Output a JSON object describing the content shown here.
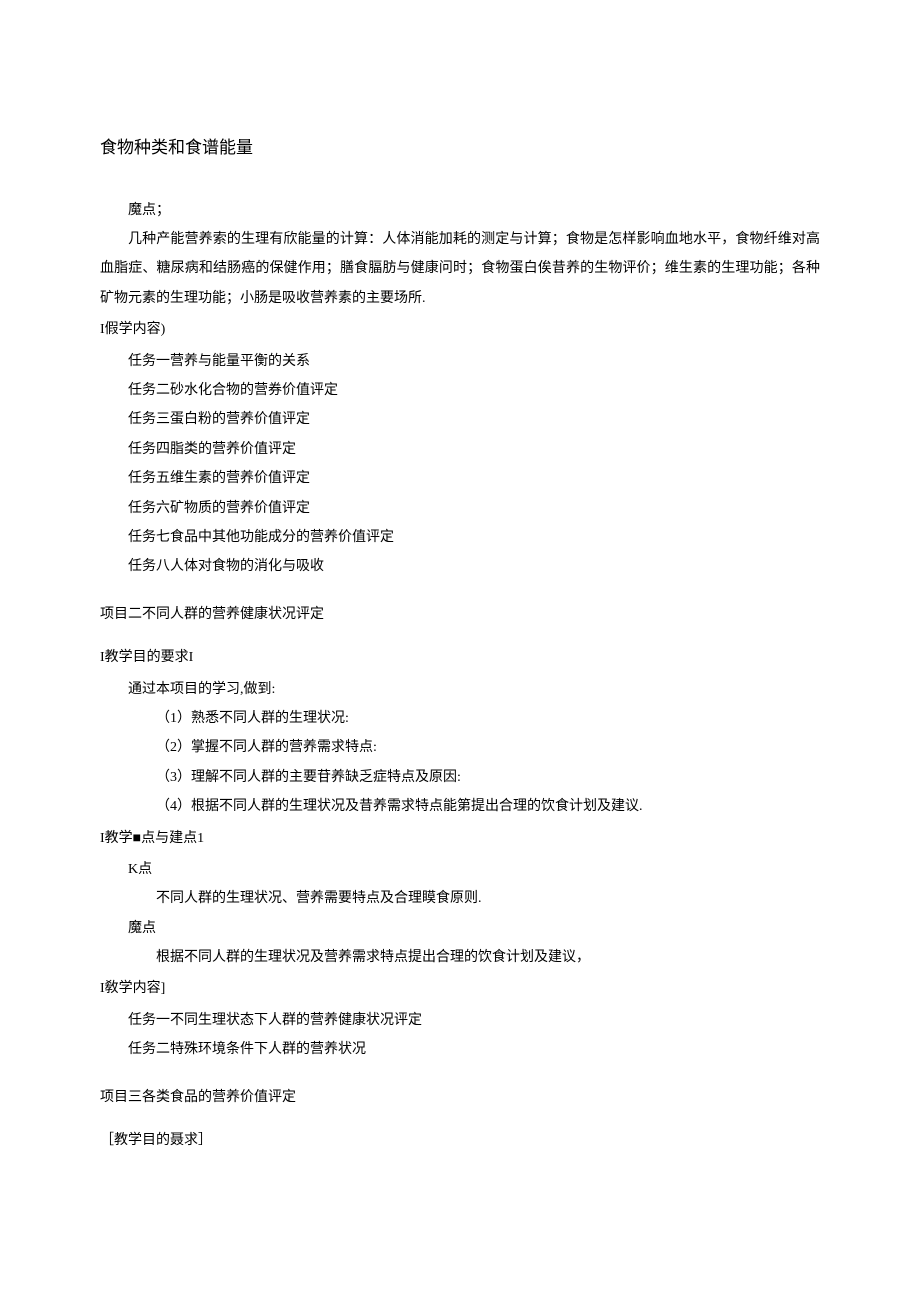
{
  "title": "食物种类和食谱能量",
  "nandian_label": "魔点；",
  "nandian_body": "几种产能营养索的生理有欣能量的计算：人体消能加耗的测定与计算；食物是怎样影响血地水平，食物纤维对高血脂症、糖尿病和结肠癌的保健作用；膳食腷肪与健康问时；食物蛋白俟昔养的生物评价；维生素的生理功能；各种矿物元素的生理功能；小肠是吸收营养素的主要场所.",
  "p1_content_label": "I假学内容)",
  "p1_tasks": [
    "任务一营养与能量平衡的关系",
    "任务二砂水化合物的营券价值评定",
    "任务三蛋白粉的营养价值评定",
    "任务四脂类的营养价值评定",
    "任务五维生素的营养价值评定",
    "任务六矿物质的营养价值评定",
    "任务七食品中其他功能成分的营养价值评定",
    "任务八人体对食物的消化与吸收"
  ],
  "p2_title": "项目二不同人群的营养健康状况评定",
  "p2_goal_label": "I教学目的要求I",
  "p2_goal_lead": "通过本项目的学习,做到:",
  "p2_goals": [
    "（1）熟悉不同人群的生理状况:",
    "（2）掌握不同人群的营养需求特点:",
    "（3）理解不同人群的主要苷养缺乏症特点及原因:",
    "（4）根据不同人群的生理状况及昔养需求特点能第提出合理的饮食计划及建议."
  ],
  "p2_kd_label": "I教学■点与建点1",
  "p2_k_label": "K点",
  "p2_k_body": "不同人群的生理状况、营养需要特点及合理瞙食原则.",
  "p2_d_label": "魔点",
  "p2_d_body": "根据不同人群的生理状况及营养需求特点提出合理的饮食计划及建议，",
  "p2_content_label": "I敎学内容]",
  "p2_tasks": [
    "任务一不同生理状态下人群的营养健康状况评定",
    "任务二特殊环境条件下人群的营养状况"
  ],
  "p3_title": "项目三各类食品的营养价值评定",
  "p3_goal_label": "［教学目的聂求］"
}
